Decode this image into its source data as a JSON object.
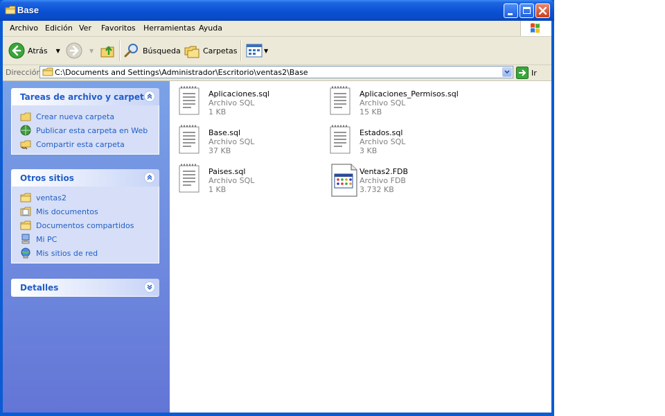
{
  "window": {
    "title": "Base"
  },
  "menu": [
    "Archivo",
    "Edición",
    "Ver",
    "Favoritos",
    "Herramientas",
    "Ayuda"
  ],
  "toolbar": {
    "back": "Atrás",
    "search": "Búsqueda",
    "folders": "Carpetas"
  },
  "address": {
    "label": "Dirección",
    "path": "C:\\Documents and Settings\\Administrador\\Escritorio\\ventas2\\Base",
    "go": "Ir"
  },
  "sidebar": {
    "tasks": {
      "title": "Tareas de archivo y carpeta",
      "items": [
        "Crear nueva carpeta",
        "Publicar esta carpeta en Web",
        "Compartir esta carpeta"
      ]
    },
    "places": {
      "title": "Otros sitios",
      "items": [
        "ventas2",
        "Mis documentos",
        "Documentos compartidos",
        "Mi PC",
        "Mis sitios de red"
      ]
    },
    "details": {
      "title": "Detalles"
    }
  },
  "files": [
    {
      "name": "Aplicaciones.sql",
      "type": "Archivo SQL",
      "size": "1 KB",
      "icon": "sql-file-icon"
    },
    {
      "name": "Aplicaciones_Permisos.sql",
      "type": "Archivo SQL",
      "size": "15 KB",
      "icon": "sql-file-icon"
    },
    {
      "name": "Base.sql",
      "type": "Archivo SQL",
      "size": "37 KB",
      "icon": "sql-file-icon"
    },
    {
      "name": "Estados.sql",
      "type": "Archivo SQL",
      "size": "3 KB",
      "icon": "sql-file-icon"
    },
    {
      "name": "Paises.sql",
      "type": "Archivo SQL",
      "size": "1 KB",
      "icon": "sql-file-icon"
    },
    {
      "name": "Ventas2.FDB",
      "type": "Archivo FDB",
      "size": "3.732 KB",
      "icon": "fdb-file-icon"
    }
  ]
}
